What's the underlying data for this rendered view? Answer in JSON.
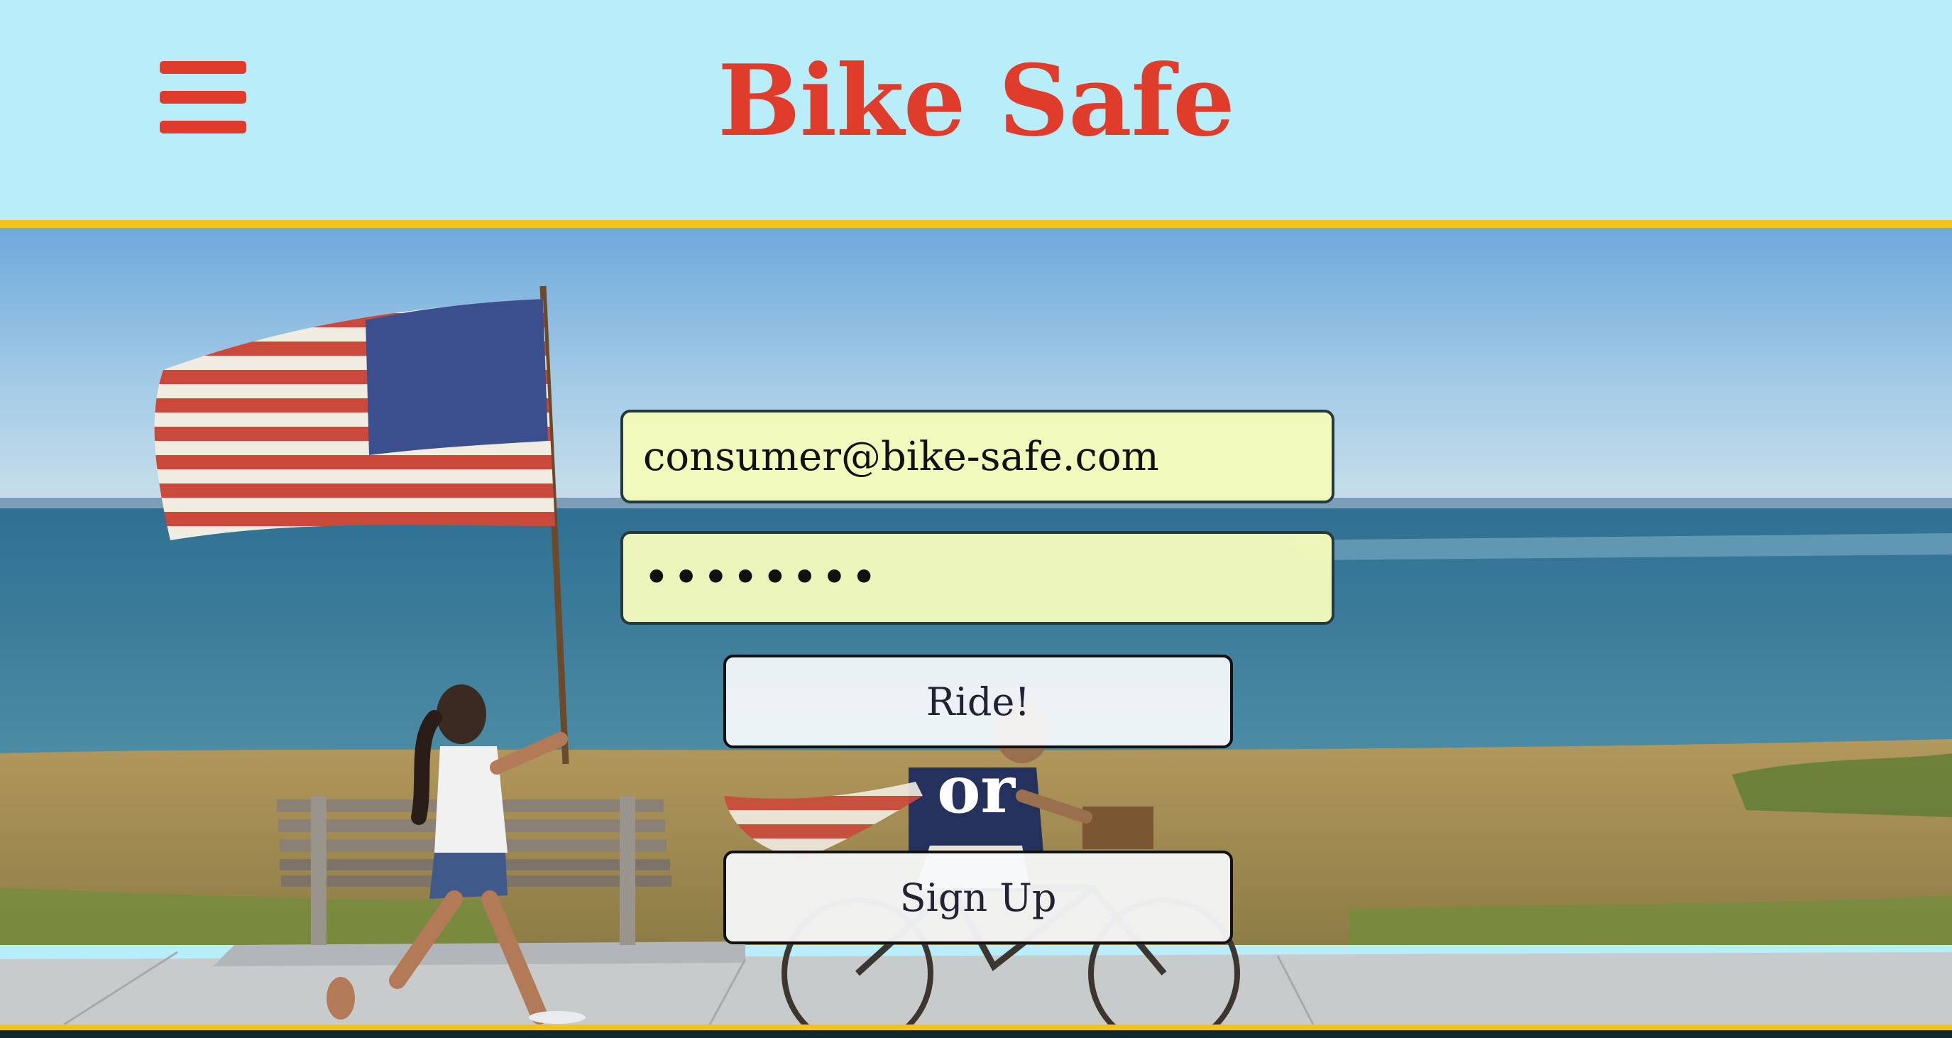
{
  "header": {
    "title": "Bike Safe",
    "menu_icon": "hamburger-menu-icon"
  },
  "login_form": {
    "email_value": "consumer@bike-safe.com",
    "password_value": "••••••••",
    "ride_label": "Ride!",
    "or_label": "or",
    "signup_label": "Sign Up"
  },
  "colors": {
    "header_background": "#b8eefa",
    "brand_red": "#e03c2c",
    "accent_yellow": "#f0c419",
    "input_background": "#f4fab8",
    "button_background": "#f8fafc"
  }
}
